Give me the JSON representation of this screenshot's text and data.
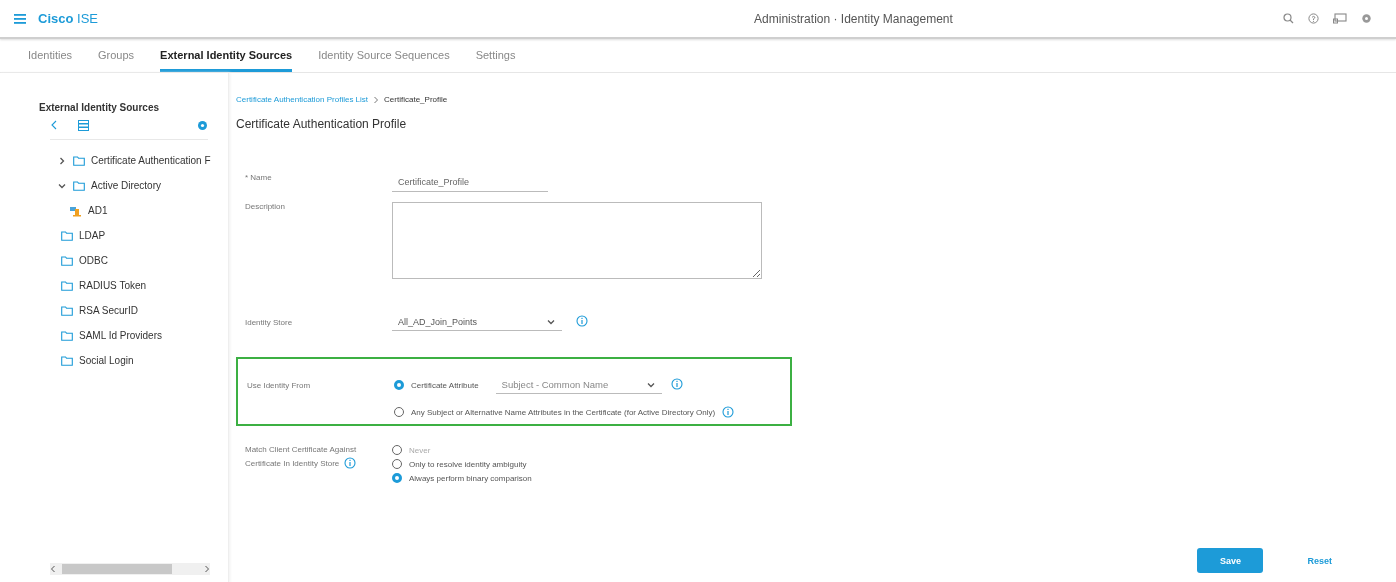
{
  "header": {
    "brand_bold": "Cisco",
    "brand_light": "ISE",
    "title": "Administration · Identity Management"
  },
  "tabs": [
    {
      "label": "Identities",
      "selected": false
    },
    {
      "label": "Groups",
      "selected": false
    },
    {
      "label": "External Identity Sources",
      "selected": true
    },
    {
      "label": "Identity Source Sequences",
      "selected": false
    },
    {
      "label": "Settings",
      "selected": false
    }
  ],
  "sidebar": {
    "title": "External Identity Sources",
    "items": [
      {
        "kind": "group",
        "label": "Certificate Authentication F",
        "expanded": false
      },
      {
        "kind": "group",
        "label": "Active Directory",
        "expanded": true,
        "children": [
          {
            "kind": "domain",
            "label": "AD1"
          }
        ]
      },
      {
        "kind": "folder",
        "label": "LDAP"
      },
      {
        "kind": "folder",
        "label": "ODBC"
      },
      {
        "kind": "folder",
        "label": "RADIUS Token"
      },
      {
        "kind": "folder",
        "label": "RSA SecurID"
      },
      {
        "kind": "folder",
        "label": "SAML Id Providers"
      },
      {
        "kind": "folder",
        "label": "Social Login"
      }
    ]
  },
  "breadcrumb": {
    "link": "Certificate Authentication Profiles List",
    "current": "Certificate_Profile"
  },
  "page_title": "Certificate Authentication Profile",
  "form": {
    "name_label": "* Name",
    "name_value": "Certificate_Profile",
    "description_label": "Description",
    "identity_store_label": "Identity Store",
    "identity_store_value": "All_AD_Join_Points",
    "use_identity_label": "Use Identity From",
    "use_identity_options": [
      {
        "label": "Certificate Attribute",
        "selected": true,
        "select_value": "Subject - Common Name"
      },
      {
        "label": "Any Subject or Alternative Name Attributes in the Certificate (for Active Directory Only)",
        "selected": false
      }
    ],
    "match_label_line1": "Match Client Certificate Against",
    "match_label_line2": "Certificate In Identity Store",
    "match_options": [
      {
        "label": "Never",
        "selected": false,
        "disabled": true
      },
      {
        "label": "Only to resolve identity ambiguity",
        "selected": false,
        "disabled": false
      },
      {
        "label": "Always perform binary comparison",
        "selected": true,
        "disabled": false
      }
    ]
  },
  "buttons": {
    "save": "Save",
    "reset": "Reset"
  }
}
